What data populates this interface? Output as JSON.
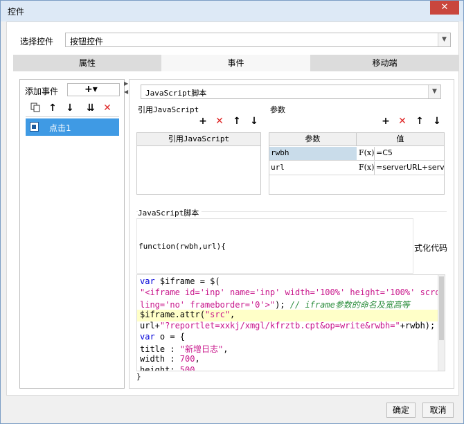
{
  "window": {
    "title": "控件",
    "close_glyph": "✕"
  },
  "select_control": {
    "label": "选择控件",
    "value": "按钮控件"
  },
  "tabs": [
    {
      "label": "属性"
    },
    {
      "label": "事件"
    },
    {
      "label": "移动端"
    }
  ],
  "events": {
    "add_label": "添加事件",
    "add_glyph": "+▾",
    "items": [
      {
        "label": "点击1",
        "icon": "event-icon"
      }
    ]
  },
  "script_type": {
    "value": "JavaScript脚本"
  },
  "ref_js": {
    "title": "引用JavaScript",
    "column": "引用JavaScript"
  },
  "params": {
    "title": "参数",
    "columns": [
      "参数",
      "值"
    ],
    "rows": [
      {
        "name": "rwbh",
        "fx": "F(x)",
        "value": "=C5"
      },
      {
        "name": "url",
        "fx": "F(x)",
        "value": "=serverURL+serv"
      }
    ]
  },
  "script": {
    "title": "JavaScript脚本",
    "signature": "function(rwbh,url){",
    "format_label": "式化代码",
    "closing": "}",
    "lines": [
      [
        {
          "t": "var ",
          "c": "kw"
        },
        {
          "t": "$iframe = $("
        }
      ],
      [
        {
          "t": "\"<iframe id='inp' name='inp' width='100%' height='100%' scrol",
          "c": "str"
        }
      ],
      [
        {
          "t": "ling='no' frameborder='0'>\"",
          "c": "str"
        },
        {
          "t": "); "
        },
        {
          "t": "// iframe参数的命名及宽高等",
          "c": "cmt"
        }
      ],
      [
        {
          "t": "$iframe.attr("
        },
        {
          "t": "\"src\"",
          "c": "str"
        },
        {
          "t": ","
        }
      ],
      [
        {
          "t": "url+"
        },
        {
          "t": "\"?reportlet=xxkj/xmgl/kfrztb.cpt&op=write&rwbh=\"",
          "c": "str"
        },
        {
          "t": "+rwbh);"
        }
      ],
      [
        {
          "t": "var ",
          "c": "kw"
        },
        {
          "t": "o = {"
        }
      ],
      [
        {
          "t": "title : "
        },
        {
          "t": "\"新增日志\"",
          "c": "str"
        },
        {
          "t": ","
        }
      ],
      [
        {
          "t": "width : "
        },
        {
          "t": "700",
          "c": "num"
        },
        {
          "t": ","
        }
      ],
      [
        {
          "t": "height: "
        },
        {
          "t": "500",
          "c": "num"
        }
      ]
    ]
  },
  "footer": {
    "ok_label": "确定",
    "cancel_label": "取消"
  }
}
